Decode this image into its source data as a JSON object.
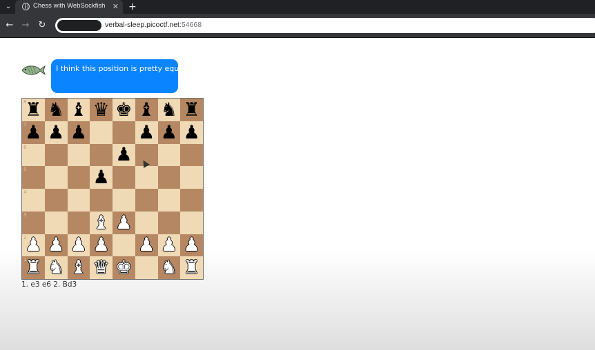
{
  "browser": {
    "tab_title": "Chess with WebSockfish",
    "tab_close_icon": "close-icon",
    "new_tab_label": "+",
    "tab_menu_icon": "chevron-down-icon",
    "url_host": "verbal-sleep.picoctf.net",
    "url_port": ":54668",
    "nav": {
      "back_icon": "←",
      "forward_icon": "→",
      "reload_icon": "↻"
    }
  },
  "chat": {
    "avatar_icon": "fish-icon",
    "message": "I think this position is pretty equal",
    "bubble_color": "#0a84ff"
  },
  "board": {
    "light_color": "#f0d9b5",
    "dark_color": "#b58863",
    "ranks": [
      [
        "r",
        "n",
        "b",
        "q",
        "k",
        "b",
        "n",
        "r"
      ],
      [
        "p",
        "p",
        "p",
        "",
        "",
        "p",
        "p",
        "p"
      ],
      [
        "",
        "",
        "",
        "",
        "p",
        "",
        "",
        ""
      ],
      [
        "",
        "",
        "",
        "p",
        "",
        "",
        "",
        ""
      ],
      [
        "",
        "",
        "",
        "",
        "",
        "",
        "",
        ""
      ],
      [
        "",
        "",
        "",
        "B",
        "P",
        "",
        "",
        ""
      ],
      [
        "P",
        "P",
        "P",
        "P",
        "",
        "P",
        "P",
        "P"
      ],
      [
        "R",
        "N",
        "B",
        "Q",
        "K",
        "",
        "N",
        "R"
      ]
    ],
    "rank_labels": [
      "8",
      "7",
      "6",
      "5",
      "4",
      "3",
      "2",
      "1"
    ]
  },
  "moves": "1. e3 e6 2. Bd3"
}
